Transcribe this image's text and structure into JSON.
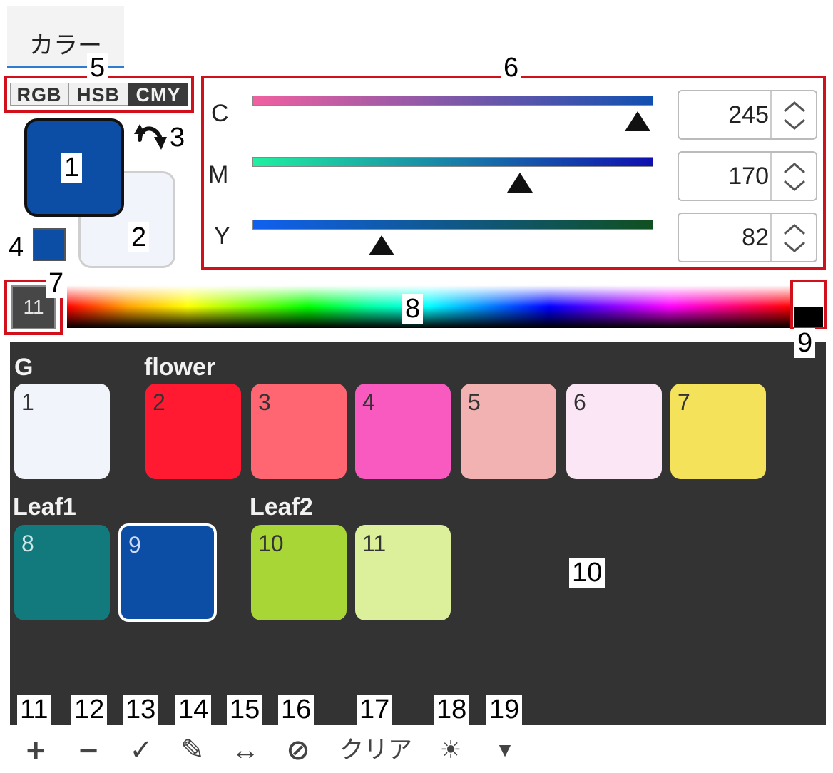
{
  "tab": {
    "label": "カラー"
  },
  "mode_switch": {
    "options": [
      "RGB",
      "HSB",
      "CMY"
    ],
    "active": "CMY"
  },
  "colors": {
    "main": "#0c4ea6",
    "sub": "#f1f4fb",
    "main_history": "#0c4ea6"
  },
  "sliders": [
    {
      "label": "C",
      "value": "245",
      "fraction": 0.961,
      "gradient": [
        "#f060a0",
        "#1050b0"
      ]
    },
    {
      "label": "M",
      "value": "170",
      "fraction": 0.667,
      "gradient": [
        "#20f0a0",
        "#1010b0"
      ]
    },
    {
      "label": "Y",
      "value": "82",
      "fraction": 0.322,
      "gradient": [
        "#1060f0",
        "#105020"
      ]
    }
  ],
  "hue_bar": {
    "current_index": "11"
  },
  "palette": {
    "groups": [
      {
        "name": "G",
        "chips": [
          {
            "num": "1",
            "color": "#f1f4fb"
          }
        ]
      },
      {
        "name": "flower",
        "chips": [
          {
            "num": "2",
            "color": "#ff1a32"
          },
          {
            "num": "3",
            "color": "#ff6672"
          },
          {
            "num": "4",
            "color": "#f85ac0"
          },
          {
            "num": "5",
            "color": "#f2b2b2"
          },
          {
            "num": "6",
            "color": "#fbe6f6"
          },
          {
            "num": "7",
            "color": "#f4e25a"
          }
        ]
      },
      {
        "name": "Leaf1",
        "chips": [
          {
            "num": "8",
            "color": "#127a7c"
          },
          {
            "num": "9",
            "color": "#0c4ea6",
            "selected": true
          }
        ]
      },
      {
        "name": "Leaf2",
        "chips": [
          {
            "num": "10",
            "color": "#a8d636"
          },
          {
            "num": "11",
            "color": "#dcf09c"
          }
        ]
      }
    ]
  },
  "toolbar": {
    "add": "+",
    "remove": "−",
    "apply": "✓",
    "edit": "✎",
    "swap": "↔",
    "disable": "⊘",
    "clear": "クリア",
    "brightness": "☀",
    "menu": "▼"
  },
  "callouts": [
    "1",
    "2",
    "3",
    "4",
    "5",
    "6",
    "7",
    "8",
    "9",
    "10",
    "11",
    "12",
    "13",
    "14",
    "15",
    "16",
    "17",
    "18",
    "19"
  ]
}
